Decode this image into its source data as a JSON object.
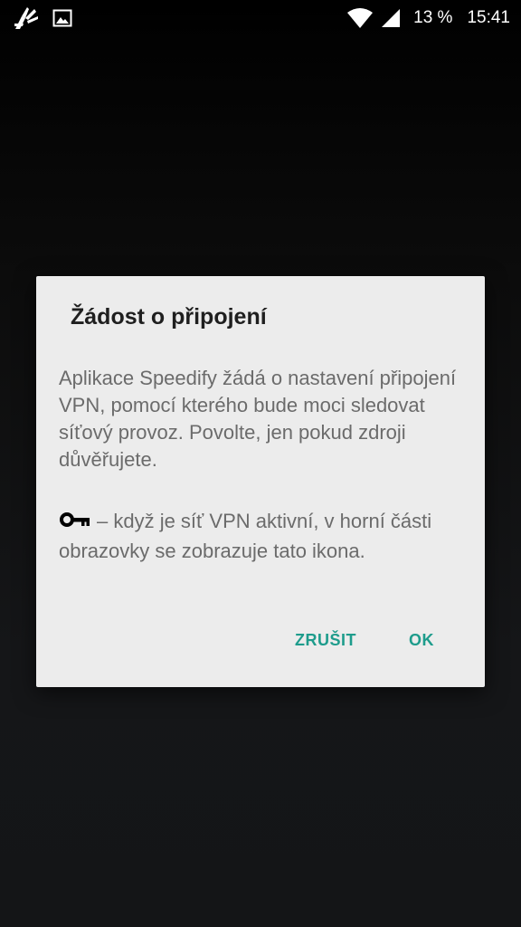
{
  "status_bar": {
    "battery_percent": "13 %",
    "time": "15:41",
    "icons": [
      "app-logo-icon",
      "image-notification-icon",
      "wifi-icon",
      "cellular-signal-icon"
    ]
  },
  "dialog": {
    "title": "Žádost o připojení",
    "body": "Aplikace Speedify žádá o nastavení připojení VPN, pomocí kterého bude moci sledovat síťový provoz. Povolte, jen pokud zdroji důvěřujete.",
    "note": "– když je síť VPN aktivní, v horní části obrazovky se zobrazuje tato ikona.",
    "note_icon": "key-icon",
    "cancel_label": "ZRUŠIT",
    "ok_label": "OK",
    "accent_color": "#1e9c8c"
  }
}
